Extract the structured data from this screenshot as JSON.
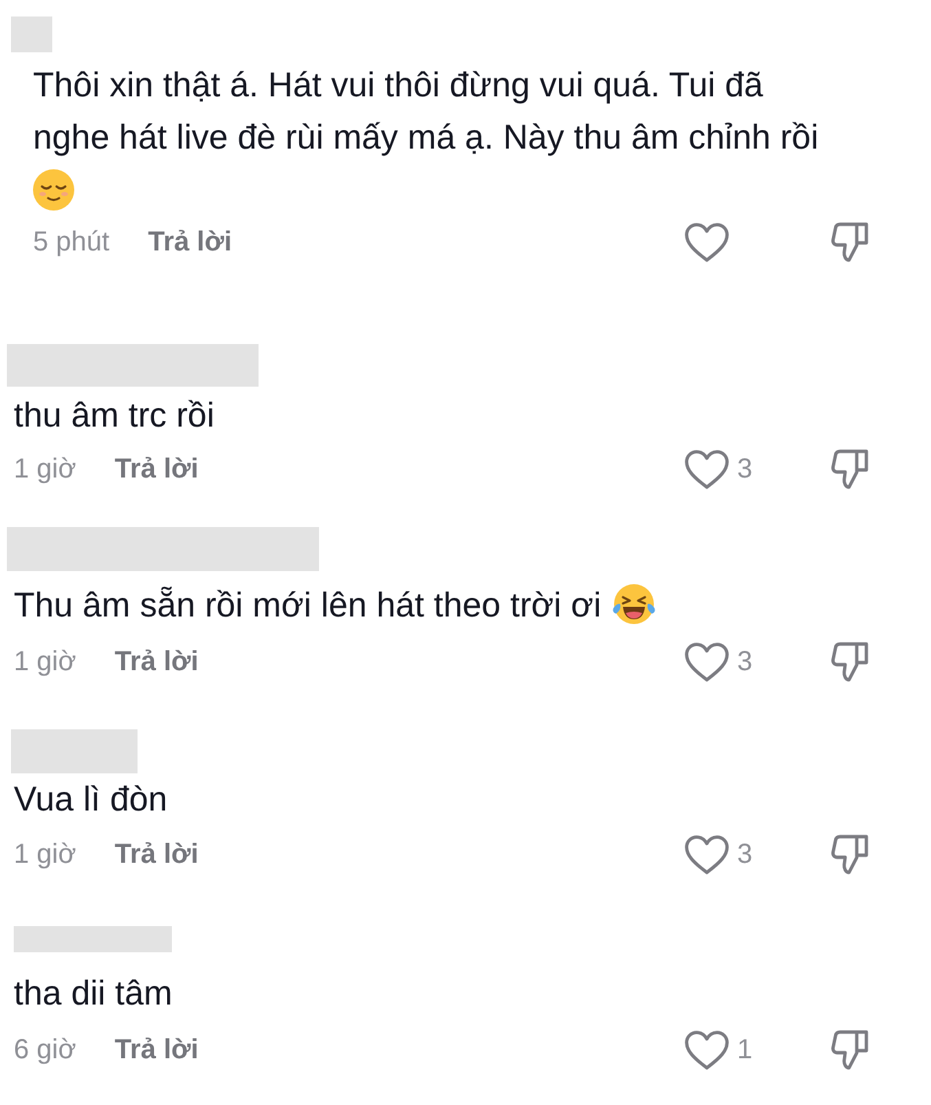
{
  "comments": [
    {
      "text": "Thôi xin thật á. Hát vui thôi đừng vui quá. Tui đã nghe hát live đè rùi mấy má ạ. Này thu âm chỉnh rồi",
      "emoji": {
        "kind": "relieved"
      },
      "time": "5 phút",
      "reply": "Trả lời",
      "liked": false
    },
    {
      "text": "thu âm trc rồi",
      "time": "1 giờ",
      "reply": "Trả lời",
      "liked": false,
      "likes": "3"
    },
    {
      "text": "Thu âm sẵn rồi mới lên hát theo trời ơi",
      "emoji": {
        "kind": "tears_of_joy"
      },
      "time": "1 giờ",
      "reply": "Trả lời",
      "liked": false,
      "likes": "3"
    },
    {
      "text": "Vua lì đòn",
      "time": "1 giờ",
      "reply": "Trả lời",
      "liked": false,
      "likes": "3"
    },
    {
      "text": "tha dii tâm",
      "time": "6 giờ",
      "reply": "Trả lời",
      "liked": false,
      "likes": "1"
    }
  ]
}
